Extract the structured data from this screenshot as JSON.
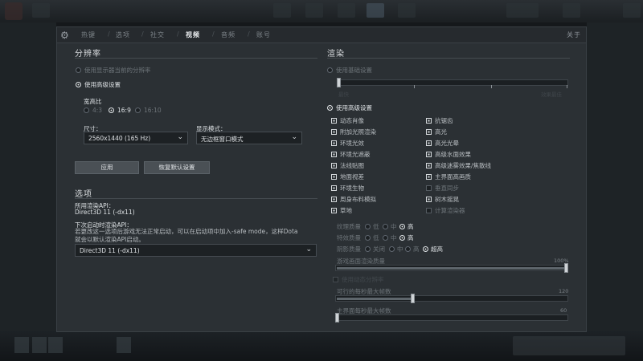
{
  "nav": {
    "tabs": [
      "热键",
      "选项",
      "社交",
      "视频",
      "音频",
      "账号"
    ],
    "active": "视频",
    "close": "关于"
  },
  "resolution": {
    "title": "分辨率",
    "use_display_res": "使用显示器当前的分辨率",
    "use_advanced": "使用高级设置",
    "aspect_label": "宽高比",
    "aspects": [
      "4:3",
      "16:9",
      "16:10"
    ],
    "size_label": "尺寸：",
    "size_value": "2560x1440 (165 Hz)",
    "display_mode_label": "显示模式：",
    "display_mode_value": "无边框窗口模式",
    "apply": "应用",
    "restore": "恢复默认设置"
  },
  "options": {
    "title": "选项",
    "api_label": "所用渲染API：",
    "api_value": "Direct3D 11 (-dx11)",
    "next_api_label": "下次启动时渲染API：",
    "next_api_note": "若更改这一选项后游戏无法正常启动，可以在启动项中加入-safe mode，这样Dota就会以默认渲染API启动。",
    "next_api_value": "Direct3D 11 (-dx11)"
  },
  "render": {
    "title": "渲染",
    "use_basic": "使用基础设置",
    "basic_left": "最快",
    "basic_right": "效果最佳",
    "use_advanced": "使用高级设置",
    "left_checks": [
      {
        "label": "动态肖像",
        "on": true
      },
      {
        "label": "附加光照渲染",
        "on": true
      },
      {
        "label": "环境光效",
        "on": true
      },
      {
        "label": "环境光遮蔽",
        "on": true
      },
      {
        "label": "法线贴图",
        "on": true
      },
      {
        "label": "地面视差",
        "on": true
      },
      {
        "label": "环境生物",
        "on": true
      },
      {
        "label": "周身布料模拟",
        "on": true
      },
      {
        "label": "草地",
        "on": true
      }
    ],
    "right_checks": [
      {
        "label": "抗锯齿",
        "on": true
      },
      {
        "label": "高光",
        "on": true
      },
      {
        "label": "高光光晕",
        "on": true
      },
      {
        "label": "高级水面效果",
        "on": true
      },
      {
        "label": "高级迷雾效果/焦散线",
        "on": true
      },
      {
        "label": "主界面高画质",
        "on": true
      },
      {
        "label": "垂直同步",
        "on": false
      },
      {
        "label": "树木摇晃",
        "on": true
      },
      {
        "label": "计算渲染器",
        "on": false
      }
    ],
    "texture_label": "纹理质量",
    "effects_label": "特效质量",
    "shadow_label": "阴影质量",
    "q_low": "低",
    "q_mid": "中",
    "q_high": "高",
    "q_off": "关闭",
    "q_ultra": "超高",
    "texture_value": "高",
    "effects_value": "高",
    "shadow_value": "超高",
    "screen_quality_label": "游戏画面渲染质量",
    "screen_quality_value": "100%",
    "screen_quality_fraction": 1.0,
    "dynamic_res_label": "使用动态分辨率",
    "max_fps_label": "可行的每秒最大帧数",
    "max_fps_value": "120",
    "max_fps_fraction": 0.33,
    "menu_fps_label": "主界面每秒最大帧数",
    "menu_fps_value": "60",
    "menu_fps_fraction": 0.0
  }
}
